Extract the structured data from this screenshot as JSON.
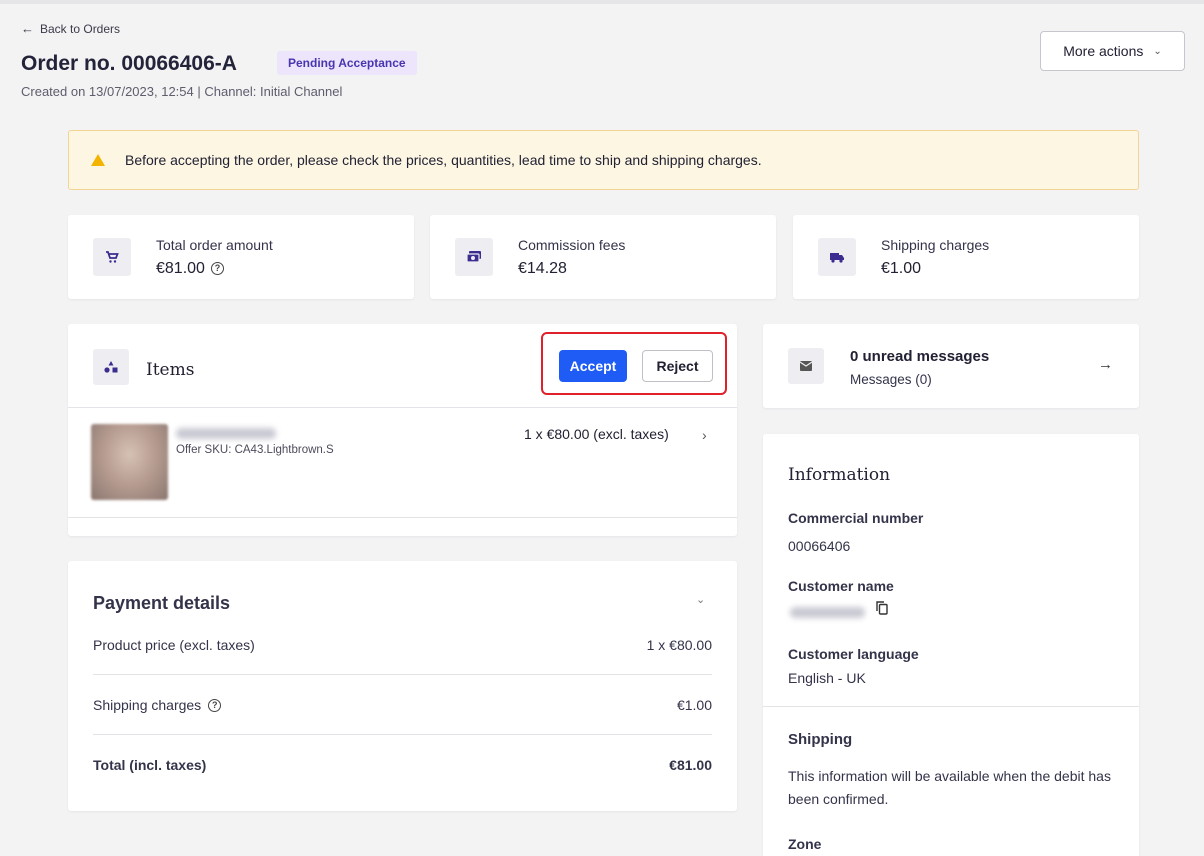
{
  "header": {
    "back_label": "Back to Orders",
    "order_title": "Order no. 00066406-A",
    "status_badge": "Pending Acceptance",
    "meta": "Created on 13/07/2023, 12:54 | Channel: Initial Channel",
    "more_actions_label": "More actions"
  },
  "banner": {
    "text": "Before accepting the order, please check the prices, quantities, lead time to ship and shipping charges."
  },
  "stats": [
    {
      "label": "Total order amount",
      "value": "€81.00",
      "icon": "cart-icon"
    },
    {
      "label": "Commission fees",
      "value": "€14.28",
      "icon": "money-icon"
    },
    {
      "label": "Shipping charges",
      "value": "€1.00",
      "icon": "truck-icon"
    }
  ],
  "items": {
    "title": "Items",
    "accept_label": "Accept",
    "reject_label": "Reject",
    "rows": [
      {
        "sku": "Offer SKU: CA43.Lightbrown.S",
        "price": "1 x €80.00 (excl. taxes)"
      }
    ]
  },
  "payment": {
    "title": "Payment details",
    "rows": [
      {
        "label": "Product price (excl. taxes)",
        "value": "1 x €80.00"
      },
      {
        "label": "Shipping charges",
        "value": "€1.00"
      },
      {
        "label": "Total (incl. taxes)",
        "value": "€81.00"
      }
    ]
  },
  "messages": {
    "title": "0 unread messages",
    "subtitle": "Messages (0)"
  },
  "information": {
    "title": "Information",
    "commercial_number_label": "Commercial number",
    "commercial_number_value": "00066406",
    "customer_name_label": "Customer name",
    "customer_language_label": "Customer language",
    "customer_language_value": "English - UK",
    "shipping_title": "Shipping",
    "shipping_text": "This information will be available when the debit has been confirmed.",
    "zone_label": "Zone"
  },
  "colors": {
    "accent": "#1f5bf5",
    "badge_bg": "#ece5fb",
    "badge_text": "#4a35b0",
    "highlight": "#e0202a",
    "warning": "#f2b400"
  }
}
